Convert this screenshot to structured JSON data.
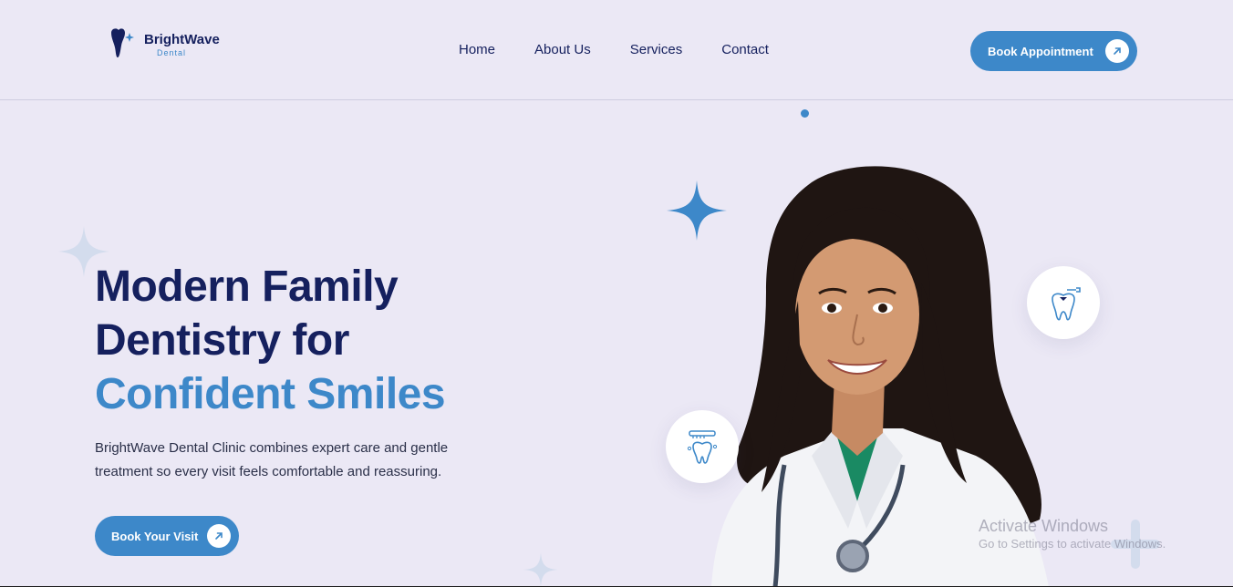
{
  "brand": {
    "name": "BrightWave",
    "sub": "Dental"
  },
  "nav": {
    "items": [
      "Home",
      "About Us",
      "Services",
      "Contact"
    ]
  },
  "header": {
    "cta_label": "Book Appointment"
  },
  "hero": {
    "title_line1": "Modern Family",
    "title_line2": "Dentistry for",
    "title_accent": "Confident Smiles",
    "description_line1": "BrightWave Dental Clinic combines expert care and gentle",
    "description_line2": "treatment so every visit feels comfortable and reassuring.",
    "cta_label": "Book Your Visit"
  },
  "watermark": {
    "title": "Activate Windows",
    "subtitle": "Go to Settings to activate Windows."
  },
  "colors": {
    "navy": "#15205e",
    "accent": "#3d88c9",
    "background": "#ebe8f5"
  },
  "icons": [
    "tooth-logo-icon",
    "arrow-up-right-icon",
    "tooth-filling-icon",
    "toothbrush-tooth-icon",
    "sparkle-icon"
  ]
}
